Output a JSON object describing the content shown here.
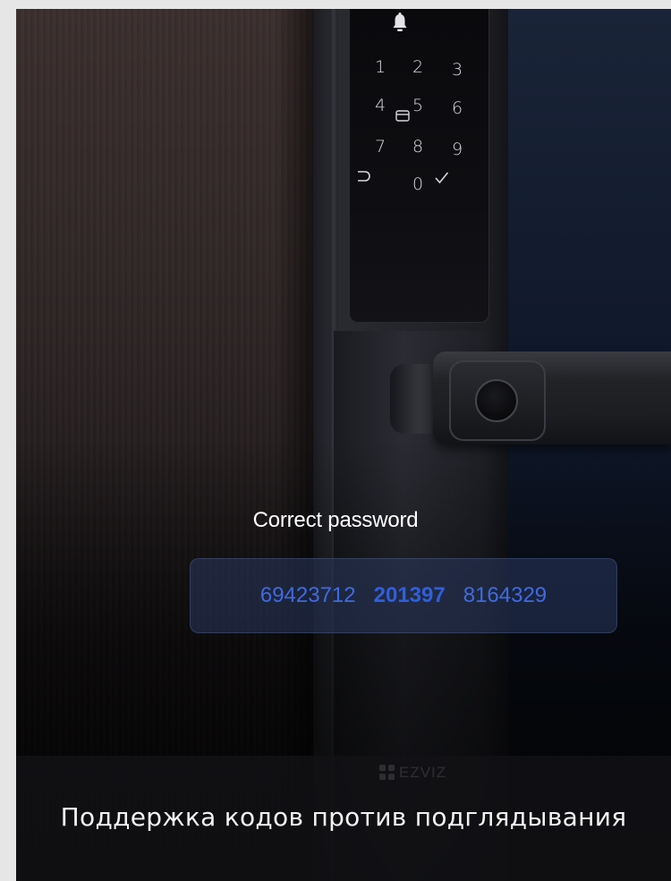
{
  "keypad": {
    "row1": [
      "1",
      "2",
      "3"
    ],
    "row2": [
      "4",
      "5",
      "6"
    ],
    "row3": [
      "7",
      "8",
      "9"
    ],
    "row4": [
      "0"
    ]
  },
  "overlay": {
    "title": "Correct password",
    "codes": [
      "69423712",
      "201397",
      "8164329"
    ]
  },
  "brand": {
    "logo_text": "EZVIZ"
  },
  "caption": "Поддержка кодов против подглядывания",
  "colors": {
    "code_text": "#3e6be0",
    "code_box": "#2a3860",
    "caption_bar": "#121216"
  }
}
